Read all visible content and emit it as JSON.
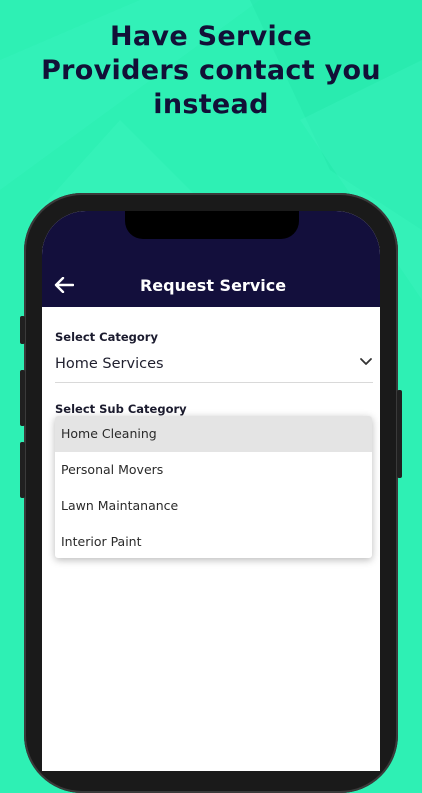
{
  "headline": {
    "line1": "Have Service",
    "line2": "Providers contact you",
    "line3": "instead"
  },
  "colors": {
    "background": "#2ef0b4",
    "headline_text": "#121037",
    "appbar": "#130f3c",
    "selected_option_bg": "#e4e4e4"
  },
  "appbar": {
    "title": "Request Service",
    "back_icon": "arrow-left-icon"
  },
  "form": {
    "category": {
      "label": "Select Category",
      "value": "Home Services",
      "icon": "chevron-down-icon"
    },
    "sub_category": {
      "label": "Select Sub Category",
      "options": [
        "Home Cleaning",
        "Personal Movers",
        "Lawn Maintanance",
        "Interior Paint"
      ],
      "highlighted": "Home Cleaning"
    }
  }
}
